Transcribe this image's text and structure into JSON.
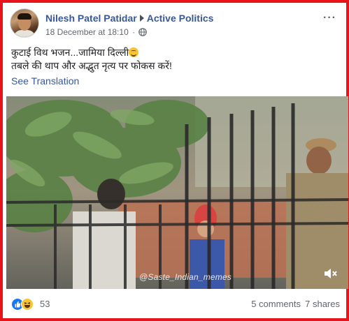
{
  "post": {
    "author": "Nilesh Patel Patidar",
    "group": "Active Politics",
    "timestamp": "18 December at 18:10",
    "separator": "·",
    "text_line1": "कुटाई विथ भजन...जामिया दिल्ली",
    "text_line2": "तबले की थाप और अद्भुत नृत्य पर फोकस करें!",
    "see_translation": "See Translation",
    "more_options": "···"
  },
  "video": {
    "watermark": "@Saste_Indian_memes",
    "mute_icon": "speaker-muted-icon"
  },
  "footer": {
    "reaction_count": "53",
    "comments": "5 comments",
    "shares": "7 shares"
  },
  "icons": {
    "globe": "globe-icon",
    "like": "like-reaction-icon",
    "haha": "haha-reaction-icon",
    "emoji": "smiling-face-emoji"
  },
  "colors": {
    "border": "#e8141b",
    "link": "#385898",
    "muted_text": "#616770",
    "like_blue": "#1877f2",
    "haha_yellow": "#f7c531"
  }
}
